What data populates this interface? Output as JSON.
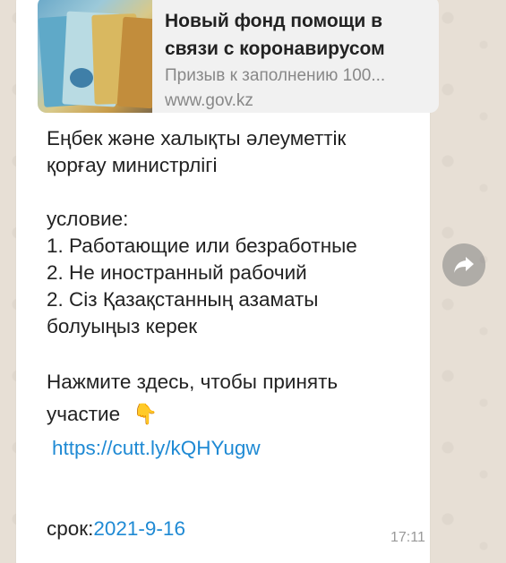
{
  "link_preview": {
    "title_line1": "Новый фонд помощи в",
    "title_line2": "связи с коронавирусом",
    "description": "Призыв к заполнению 100...",
    "domain": "www.gov.kz"
  },
  "message": {
    "org_line1": "Еңбек және халықты әлеуметтік",
    "org_line2": "қорғау министрлігі",
    "condition_label": "условие:",
    "condition_1": "1. Работающие или безработные",
    "condition_2": "2. Не иностранный рабочий",
    "condition_3a": "2. Сіз Қазақстанның азаматы",
    "condition_3b": "болуыңыз керек",
    "cta_line1": "Нажмите здесь, чтобы принять",
    "cta_line2": "участие",
    "pointing_emoji": "👇",
    "link": "https://cutt.ly/kQHYugw",
    "deadline_label": "срок:",
    "deadline_date": "2021-9-16",
    "time": "17:11"
  },
  "icons": {
    "forward": "forward-arrow-icon"
  }
}
